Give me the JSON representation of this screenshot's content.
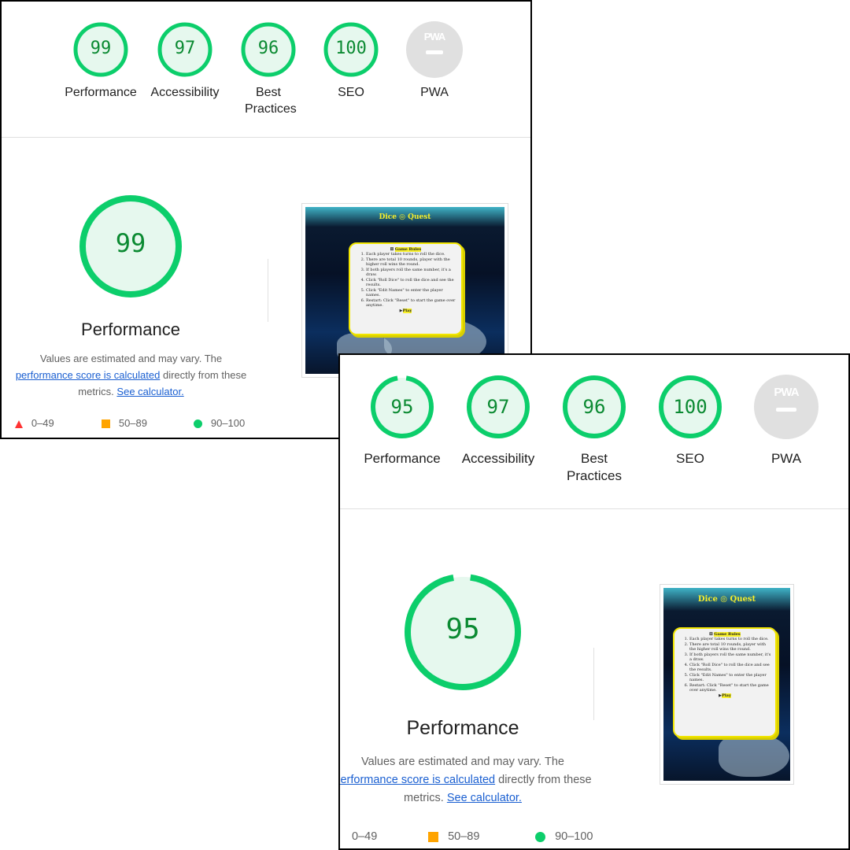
{
  "panels": [
    {
      "scores": [
        {
          "value": "99",
          "label": "Performance"
        },
        {
          "value": "97",
          "label": "Accessibility"
        },
        {
          "value": "96",
          "label": "Best Practices"
        },
        {
          "value": "100",
          "label": "SEO"
        },
        {
          "value": "",
          "label": "PWA"
        }
      ],
      "pwa_badge": "PWA",
      "main_score": "99",
      "main_title": "Performance",
      "desc_prefix": "Values are estimated and may vary. The",
      "desc_link": "performance score is calculated",
      "desc_mid": "directly from these metrics.",
      "desc_calc": "See calculator.",
      "legend": {
        "fail": "0–49",
        "average": "50–89",
        "pass": "90–100"
      }
    },
    {
      "scores": [
        {
          "value": "95",
          "label": "Performance"
        },
        {
          "value": "97",
          "label": "Accessibility"
        },
        {
          "value": "96",
          "label": "Best Practices"
        },
        {
          "value": "100",
          "label": "SEO"
        },
        {
          "value": "",
          "label": "PWA"
        }
      ],
      "pwa_badge": "PWA",
      "main_score": "95",
      "main_title": "Performance",
      "desc_prefix": "Values are estimated and may vary. The",
      "desc_link": "performance score is calculated",
      "desc_mid": "directly from these metrics.",
      "desc_calc": "See calculator.",
      "legend": {
        "fail": "0–49",
        "average": "50–89",
        "pass": "90–100"
      }
    }
  ],
  "screenshot": {
    "title_left": "Dice",
    "title_right": "Quest",
    "rules_heading": "Game Rules",
    "rules": [
      "Each player takes turns to roll the dice.",
      "There are total 10 rounds, player with the higher roll wins the round.",
      "If both players roll the same number, it's a draw.",
      "Click \"Roll Dice\" to roll the dice and see the results.",
      "Click \"Edit Names\" to enter the player names.",
      "Restart: Click \"Reset\" to start the game over anytime."
    ],
    "play": "Play"
  },
  "colors": {
    "pass": "#0cce6b",
    "pass_text": "#0b8a32",
    "pass_fill": "#e6f8ee",
    "average": "#ffa400",
    "fail": "#ff3333",
    "link": "#1a5fd1"
  }
}
